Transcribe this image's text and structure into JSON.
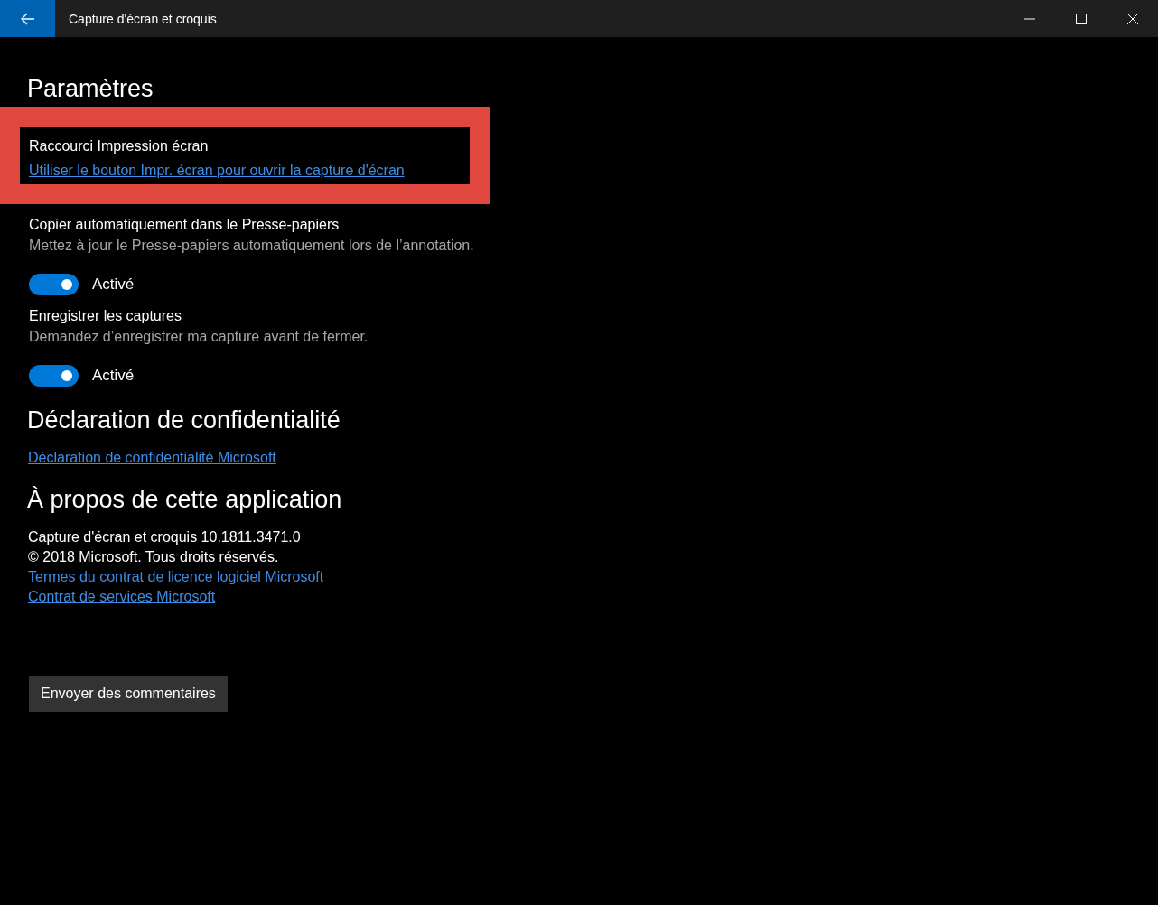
{
  "window": {
    "title": "Capture d'écran et croquis"
  },
  "settings": {
    "heading": "Paramètres",
    "items": [
      {
        "kind": "link",
        "label": "Raccourci Impression écran",
        "link": "Utiliser le bouton Impr. écran pour ouvrir la capture d'écran",
        "highlighted": true
      },
      {
        "kind": "toggle",
        "label": "Copier automatiquement dans le Presse-papiers",
        "description": "Mettez à jour le Presse-papiers automatiquement lors de l’annotation.",
        "on": true,
        "state_label": "Activé"
      },
      {
        "kind": "toggle",
        "label": "Enregistrer les captures",
        "description": "Demandez d’enregistrer ma capture avant de fermer.",
        "on": true,
        "state_label": "Activé"
      }
    ]
  },
  "privacy": {
    "heading": "Déclaration de confidentialité",
    "link": "Déclaration de confidentialité Microsoft"
  },
  "about": {
    "heading": "À propos de cette application",
    "lines": [
      {
        "kind": "text",
        "text": "Capture d'écran et croquis 10.1811.3471.0"
      },
      {
        "kind": "text",
        "text": "© 2018 Microsoft. Tous droits réservés."
      },
      {
        "kind": "link",
        "text": "Termes du contrat de licence logiciel Microsoft"
      },
      {
        "kind": "link",
        "text": "Contrat de services Microsoft"
      }
    ]
  },
  "feedback_button": "Envoyer des commentaires"
}
